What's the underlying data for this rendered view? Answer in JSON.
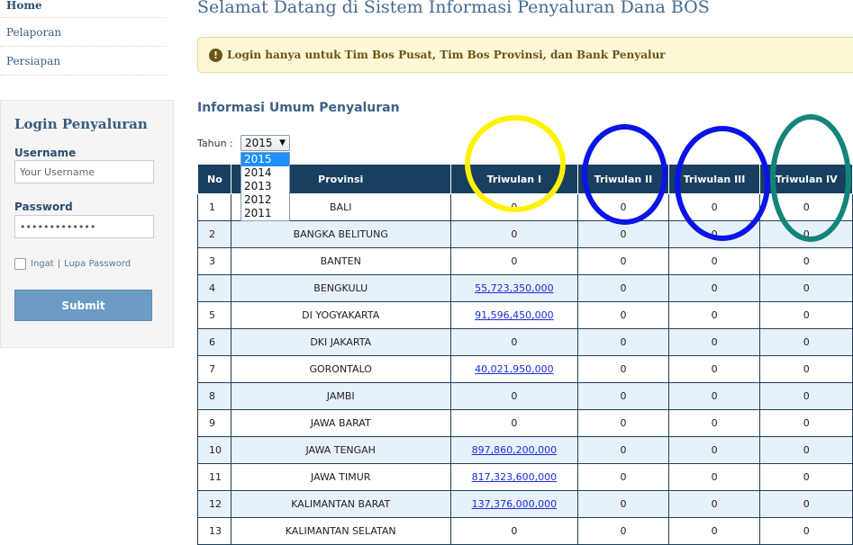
{
  "nav": {
    "items": [
      "Home",
      "Pelaporan",
      "Persiapan"
    ]
  },
  "login": {
    "title": "Login Penyaluran",
    "username_label": "Username",
    "username_placeholder": "Your Username",
    "password_label": "Password",
    "password_value": "•••••••••••••",
    "remember_label": "Ingat",
    "separator": "|",
    "forgot_label": "Lupa Password",
    "submit_label": "Submit"
  },
  "page": {
    "title": "Selamat Datang di Sistem Informasi Penyaluran Dana BOS",
    "alert_icon": "!",
    "alert_text": "Login hanya untuk Tim Bos Pusat, Tim Bos Provinsi, dan Bank Penyalur",
    "section_title": "Informasi Umum Penyaluran"
  },
  "filter": {
    "label": "Tahun :",
    "selected": "2015",
    "arrow": "▼",
    "options": [
      "2015",
      "2014",
      "2013",
      "2012",
      "2011"
    ]
  },
  "table": {
    "headers": [
      "No",
      "Provinsi",
      "Triwulan I",
      "Triwulan II",
      "Triwulan III",
      "Triwulan IV"
    ],
    "rows": [
      [
        "1",
        "BALI",
        "0",
        "0",
        "0",
        "0"
      ],
      [
        "2",
        "BANGKA BELITUNG",
        "0",
        "0",
        "0",
        "0"
      ],
      [
        "3",
        "BANTEN",
        "0",
        "0",
        "0",
        "0"
      ],
      [
        "4",
        "BENGKULU",
        "55,723,350,000",
        "0",
        "0",
        "0"
      ],
      [
        "5",
        "DI YOGYAKARTA",
        "91,596,450,000",
        "0",
        "0",
        "0"
      ],
      [
        "6",
        "DKI JAKARTA",
        "0",
        "0",
        "0",
        "0"
      ],
      [
        "7",
        "GORONTALO",
        "40,021,950,000",
        "0",
        "0",
        "0"
      ],
      [
        "8",
        "JAMBI",
        "0",
        "0",
        "0",
        "0"
      ],
      [
        "9",
        "JAWA BARAT",
        "0",
        "0",
        "0",
        "0"
      ],
      [
        "10",
        "JAWA TENGAH",
        "897,860,200,000",
        "0",
        "0",
        "0"
      ],
      [
        "11",
        "JAWA TIMUR",
        "817,323,600,000",
        "0",
        "0",
        "0"
      ],
      [
        "12",
        "KALIMANTAN BARAT",
        "137,376,000,000",
        "0",
        "0",
        "0"
      ],
      [
        "13",
        "KALIMANTAN SELATAN",
        "0",
        "0",
        "0",
        "0"
      ]
    ]
  },
  "annotation_colors": {
    "triwulan_1": "#fff200",
    "triwulan_2": "#0a14e6",
    "triwulan_3": "#0a14e6",
    "triwulan_4": "#128578"
  }
}
